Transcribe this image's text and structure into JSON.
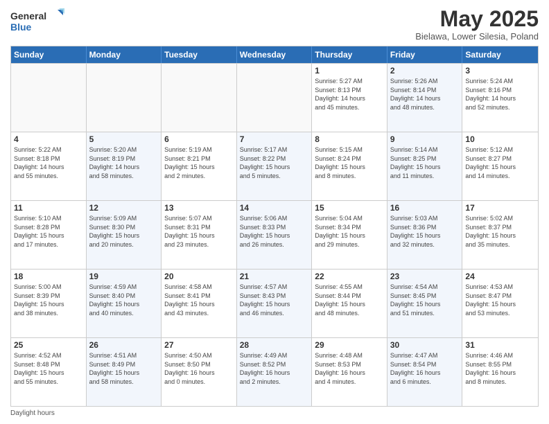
{
  "logo": {
    "line1": "General",
    "line2": "Blue"
  },
  "title": "May 2025",
  "location": "Bielawa, Lower Silesia, Poland",
  "header_days": [
    "Sunday",
    "Monday",
    "Tuesday",
    "Wednesday",
    "Thursday",
    "Friday",
    "Saturday"
  ],
  "weeks": [
    [
      {
        "day": "",
        "info": ""
      },
      {
        "day": "",
        "info": ""
      },
      {
        "day": "",
        "info": ""
      },
      {
        "day": "",
        "info": ""
      },
      {
        "day": "1",
        "info": "Sunrise: 5:27 AM\nSunset: 8:13 PM\nDaylight: 14 hours\nand 45 minutes."
      },
      {
        "day": "2",
        "info": "Sunrise: 5:26 AM\nSunset: 8:14 PM\nDaylight: 14 hours\nand 48 minutes."
      },
      {
        "day": "3",
        "info": "Sunrise: 5:24 AM\nSunset: 8:16 PM\nDaylight: 14 hours\nand 52 minutes."
      }
    ],
    [
      {
        "day": "4",
        "info": "Sunrise: 5:22 AM\nSunset: 8:18 PM\nDaylight: 14 hours\nand 55 minutes."
      },
      {
        "day": "5",
        "info": "Sunrise: 5:20 AM\nSunset: 8:19 PM\nDaylight: 14 hours\nand 58 minutes."
      },
      {
        "day": "6",
        "info": "Sunrise: 5:19 AM\nSunset: 8:21 PM\nDaylight: 15 hours\nand 2 minutes."
      },
      {
        "day": "7",
        "info": "Sunrise: 5:17 AM\nSunset: 8:22 PM\nDaylight: 15 hours\nand 5 minutes."
      },
      {
        "day": "8",
        "info": "Sunrise: 5:15 AM\nSunset: 8:24 PM\nDaylight: 15 hours\nand 8 minutes."
      },
      {
        "day": "9",
        "info": "Sunrise: 5:14 AM\nSunset: 8:25 PM\nDaylight: 15 hours\nand 11 minutes."
      },
      {
        "day": "10",
        "info": "Sunrise: 5:12 AM\nSunset: 8:27 PM\nDaylight: 15 hours\nand 14 minutes."
      }
    ],
    [
      {
        "day": "11",
        "info": "Sunrise: 5:10 AM\nSunset: 8:28 PM\nDaylight: 15 hours\nand 17 minutes."
      },
      {
        "day": "12",
        "info": "Sunrise: 5:09 AM\nSunset: 8:30 PM\nDaylight: 15 hours\nand 20 minutes."
      },
      {
        "day": "13",
        "info": "Sunrise: 5:07 AM\nSunset: 8:31 PM\nDaylight: 15 hours\nand 23 minutes."
      },
      {
        "day": "14",
        "info": "Sunrise: 5:06 AM\nSunset: 8:33 PM\nDaylight: 15 hours\nand 26 minutes."
      },
      {
        "day": "15",
        "info": "Sunrise: 5:04 AM\nSunset: 8:34 PM\nDaylight: 15 hours\nand 29 minutes."
      },
      {
        "day": "16",
        "info": "Sunrise: 5:03 AM\nSunset: 8:36 PM\nDaylight: 15 hours\nand 32 minutes."
      },
      {
        "day": "17",
        "info": "Sunrise: 5:02 AM\nSunset: 8:37 PM\nDaylight: 15 hours\nand 35 minutes."
      }
    ],
    [
      {
        "day": "18",
        "info": "Sunrise: 5:00 AM\nSunset: 8:39 PM\nDaylight: 15 hours\nand 38 minutes."
      },
      {
        "day": "19",
        "info": "Sunrise: 4:59 AM\nSunset: 8:40 PM\nDaylight: 15 hours\nand 40 minutes."
      },
      {
        "day": "20",
        "info": "Sunrise: 4:58 AM\nSunset: 8:41 PM\nDaylight: 15 hours\nand 43 minutes."
      },
      {
        "day": "21",
        "info": "Sunrise: 4:57 AM\nSunset: 8:43 PM\nDaylight: 15 hours\nand 46 minutes."
      },
      {
        "day": "22",
        "info": "Sunrise: 4:55 AM\nSunset: 8:44 PM\nDaylight: 15 hours\nand 48 minutes."
      },
      {
        "day": "23",
        "info": "Sunrise: 4:54 AM\nSunset: 8:45 PM\nDaylight: 15 hours\nand 51 minutes."
      },
      {
        "day": "24",
        "info": "Sunrise: 4:53 AM\nSunset: 8:47 PM\nDaylight: 15 hours\nand 53 minutes."
      }
    ],
    [
      {
        "day": "25",
        "info": "Sunrise: 4:52 AM\nSunset: 8:48 PM\nDaylight: 15 hours\nand 55 minutes."
      },
      {
        "day": "26",
        "info": "Sunrise: 4:51 AM\nSunset: 8:49 PM\nDaylight: 15 hours\nand 58 minutes."
      },
      {
        "day": "27",
        "info": "Sunrise: 4:50 AM\nSunset: 8:50 PM\nDaylight: 16 hours\nand 0 minutes."
      },
      {
        "day": "28",
        "info": "Sunrise: 4:49 AM\nSunset: 8:52 PM\nDaylight: 16 hours\nand 2 minutes."
      },
      {
        "day": "29",
        "info": "Sunrise: 4:48 AM\nSunset: 8:53 PM\nDaylight: 16 hours\nand 4 minutes."
      },
      {
        "day": "30",
        "info": "Sunrise: 4:47 AM\nSunset: 8:54 PM\nDaylight: 16 hours\nand 6 minutes."
      },
      {
        "day": "31",
        "info": "Sunrise: 4:46 AM\nSunset: 8:55 PM\nDaylight: 16 hours\nand 8 minutes."
      }
    ]
  ],
  "footer": "Daylight hours"
}
